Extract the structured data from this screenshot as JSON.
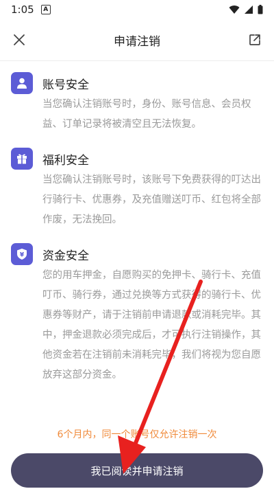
{
  "status_bar": {
    "time": "1:05",
    "notification_badge": "A"
  },
  "header": {
    "title": "申请注销",
    "close_icon": "close-icon",
    "share_icon": "external-link-icon"
  },
  "sections": [
    {
      "icon": "user-icon",
      "title": "账号安全",
      "text": "当您确认注销账号时，身份、账号信息、会员权益、订单记录将被清空且无法恢复。"
    },
    {
      "icon": "gift-icon",
      "title": "福利安全",
      "text": "当您确认注销账号时，该账号下免费获得的叮达出行骑行卡、优惠券，及充值赠送叮币、红包将全部作废，无法挽回。"
    },
    {
      "icon": "yen-shield-icon",
      "title": "资金安全",
      "text": "您的用车押金，自愿购买的免押卡、骑行卡、充值叮币、骑行券，通过兑换等方式获得的骑行卡、优惠券等财产，请于注销前申请退款或消耗完毕。其中，押金退款必须完成后，才可执行注销操作，其他资金若在注销前未消耗完毕，我们将视为您自愿放弃这部分资金。"
    }
  ],
  "notice": "6个月内，同一个账号仅允许注销一次",
  "submit_label": "我已阅读并申请注销",
  "colors": {
    "icon_bg": "#5c5cd6",
    "button_bg": "#4b4968",
    "notice": "#f08a3a",
    "arrow": "#e8211f"
  }
}
